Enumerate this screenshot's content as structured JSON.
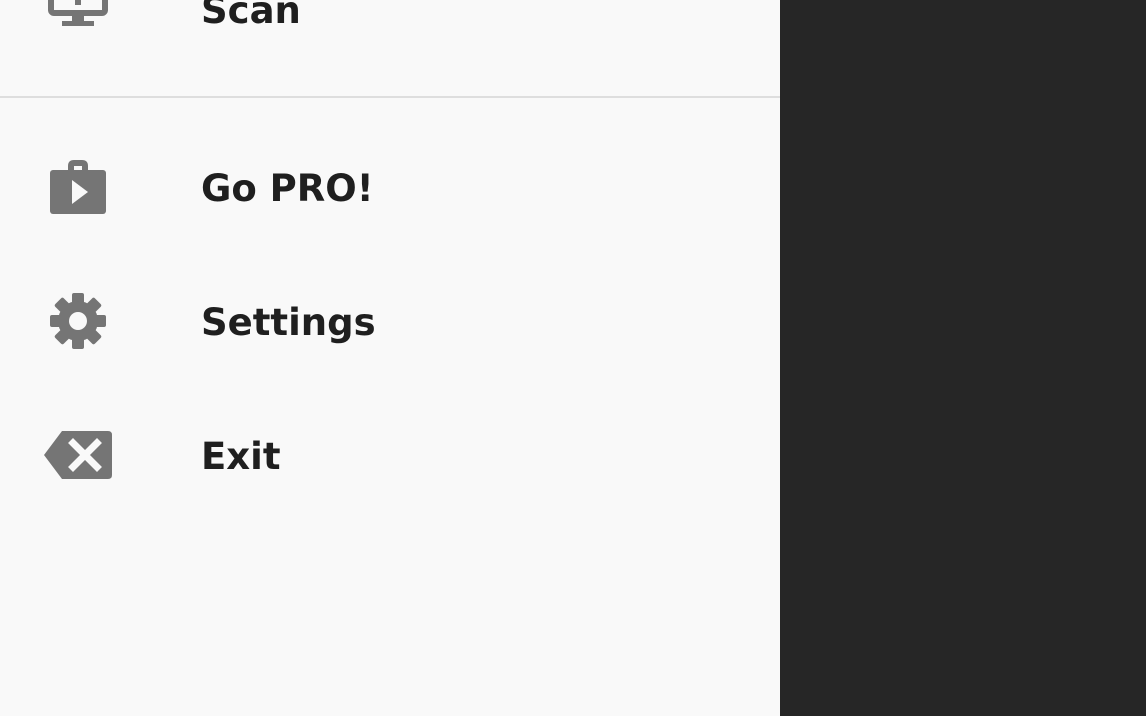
{
  "drawer": {
    "items": [
      {
        "label": "Scan",
        "icon": "scan-icon"
      },
      {
        "label": "Go PRO!",
        "icon": "shop-icon"
      },
      {
        "label": "Settings",
        "icon": "gear-icon"
      },
      {
        "label": "Exit",
        "icon": "backspace-icon"
      }
    ]
  },
  "colors": {
    "drawer_background": "#f9f9f9",
    "scrim": "#262626",
    "icon": "#757575",
    "text": "#1f1f1f",
    "divider": "#dedede"
  }
}
